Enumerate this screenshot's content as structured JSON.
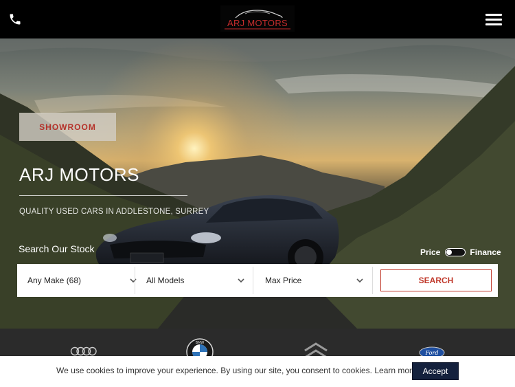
{
  "header": {
    "logo_text": "ARJ MOTORS",
    "phone_icon": "phone-icon",
    "menu_icon": "hamburger-menu-icon"
  },
  "hero": {
    "showroom_label": "SHOWROOM",
    "title": "ARJ MOTORS",
    "subtitle": "QUALITY USED CARS IN ADDLESTONE, SURREY"
  },
  "search": {
    "label": "Search Our Stock",
    "toggle_left": "Price",
    "toggle_right": "Finance",
    "make": "Any Make (68)",
    "model": "All Models",
    "price": "Max Price",
    "button": "SEARCH"
  },
  "brands": [
    "Audi",
    "BMW",
    "Citroen",
    "Ford"
  ],
  "cookie": {
    "text": "We use cookies to improve your experience. By using our site, you consent to cookies.",
    "link": "Learn more",
    "accept": "Accept"
  },
  "colors": {
    "accent": "#c0392b",
    "header_bg": "#000000",
    "brands_bg": "#2b2b2b",
    "accept_bg": "#14213d"
  }
}
